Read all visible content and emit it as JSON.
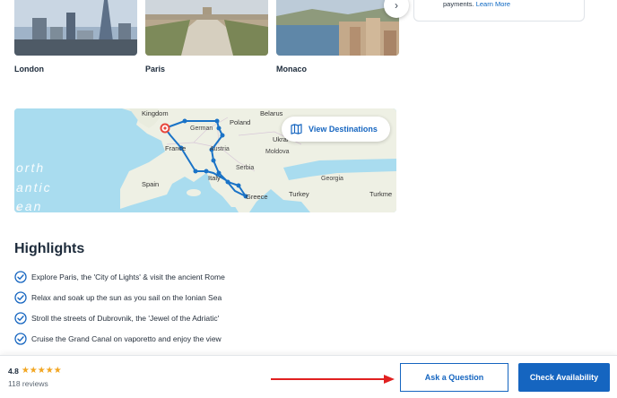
{
  "destinations": [
    {
      "name": "London",
      "icon": "london-photo"
    },
    {
      "name": "Paris",
      "icon": "paris-photo"
    },
    {
      "name": "Monaco",
      "icon": "monaco-photo"
    }
  ],
  "carousel": {
    "next_icon": "chevron-right-icon",
    "next_glyph": "›"
  },
  "side_card": {
    "text": "payments.",
    "link": "Learn More"
  },
  "map": {
    "button_label": "View Destinations",
    "labels": {
      "kingdom": "Kingdom",
      "belarus": "Belarus",
      "poland": "Poland",
      "german": "German",
      "ukraine": "Ukrai",
      "france": "France",
      "austria": "Austria",
      "moldova": "Moldova",
      "serbia": "Serbia",
      "spain": "Spain",
      "italy": "Italy",
      "georgia": "Georgia",
      "greece": "Greece",
      "turkey": "Turkey",
      "turkmen": "Turkme",
      "sea1": "orth",
      "sea2": "antic",
      "sea3": "ean"
    },
    "colors": {
      "sea": "#a9dcef",
      "land": "#eef0e4",
      "route": "#1a73c7",
      "pin": "#e8473c"
    }
  },
  "highlights": {
    "title": "Highlights",
    "items": [
      "Explore Paris, the 'City of Lights' & visit the ancient Rome",
      "Relax and soak up the sun as you sail on the Ionian Sea",
      "Stroll the streets of Dubrovnik, the 'Jewel of the Adriatic'",
      "Cruise the Grand Canal on vaporetto and enjoy the view"
    ]
  },
  "bottom_bar": {
    "rating": "4.8",
    "stars": "★★★★★",
    "reviews": "118 reviews",
    "ask_label": "Ask a Question",
    "check_label": "Check Availability"
  },
  "theme": {
    "accent": "#1565c0",
    "star": "#f2a622",
    "annotation_arrow": "#e02020"
  }
}
